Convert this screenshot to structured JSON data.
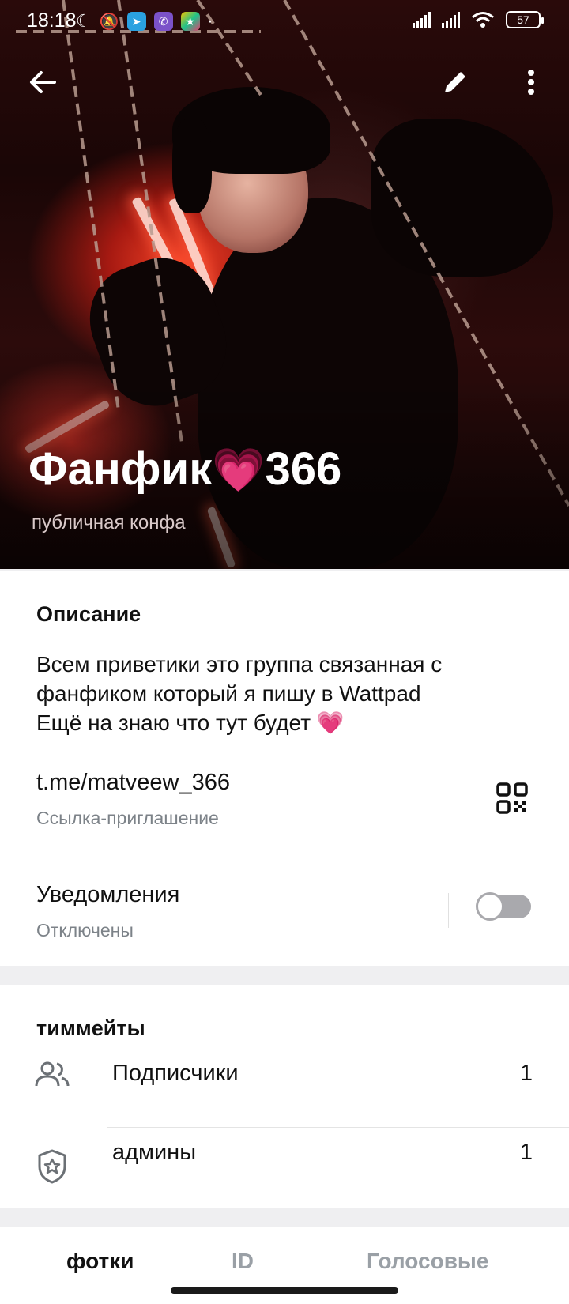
{
  "status_bar": {
    "time": "18:18",
    "battery": "57"
  },
  "header": {
    "title": "Фанфик",
    "title_emoji": "💗",
    "title_suffix": "366",
    "subtitle": "публичная конфа"
  },
  "info": {
    "section_title": "Описание",
    "description_lines": [
      "Всем приветики это группа связанная с",
      "фанфиком который я пишу в Wattpad",
      "Ещё на знаю что тут будет"
    ],
    "description_emoji": "💗",
    "link": "t.me/matveew_366",
    "link_caption": "Ссылка-приглашение",
    "notifications_label": "Уведомления",
    "notifications_state": "Отключены",
    "notifications_on": false
  },
  "members": {
    "section_title": "тиммейты",
    "rows": [
      {
        "label": "Подписчики",
        "count": "1",
        "icon": "people-icon"
      },
      {
        "label": "админы",
        "count": "1",
        "icon": "admin-shield-icon"
      }
    ]
  },
  "tabs": [
    {
      "label": "фотки",
      "active": true
    },
    {
      "label": "ID",
      "active": false
    },
    {
      "label": "Голосовые",
      "active": false
    }
  ],
  "colors": {
    "accent_heart": "#ff5ab4",
    "muted_text": "#7c8288",
    "toggle_off": "#a9a9ad"
  }
}
